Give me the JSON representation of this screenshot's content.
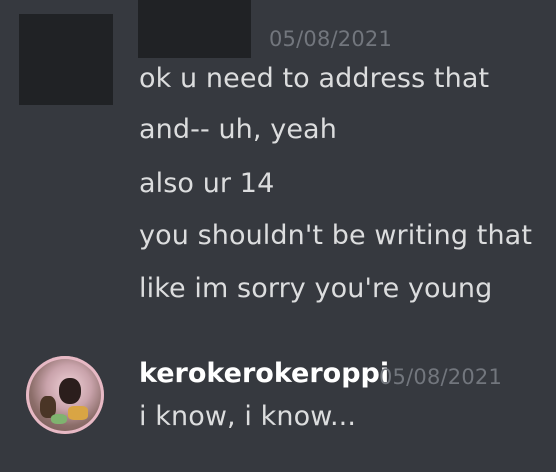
{
  "messages": [
    {
      "timestamp": "05/08/2021",
      "lines": [
        "ok u need to address that",
        "and-- uh, yeah",
        "also ur 14",
        "you shouldn't be writing that",
        "like im sorry you're young"
      ]
    },
    {
      "username": "kerokerokeroppi",
      "timestamp": "05/08/2021",
      "lines": [
        "i know, i know..."
      ]
    }
  ],
  "colors": {
    "background": "#36393f",
    "redaction": "#202225",
    "message_text": "#dcddde",
    "timestamp": "#72767d",
    "username": "#ffffff"
  }
}
